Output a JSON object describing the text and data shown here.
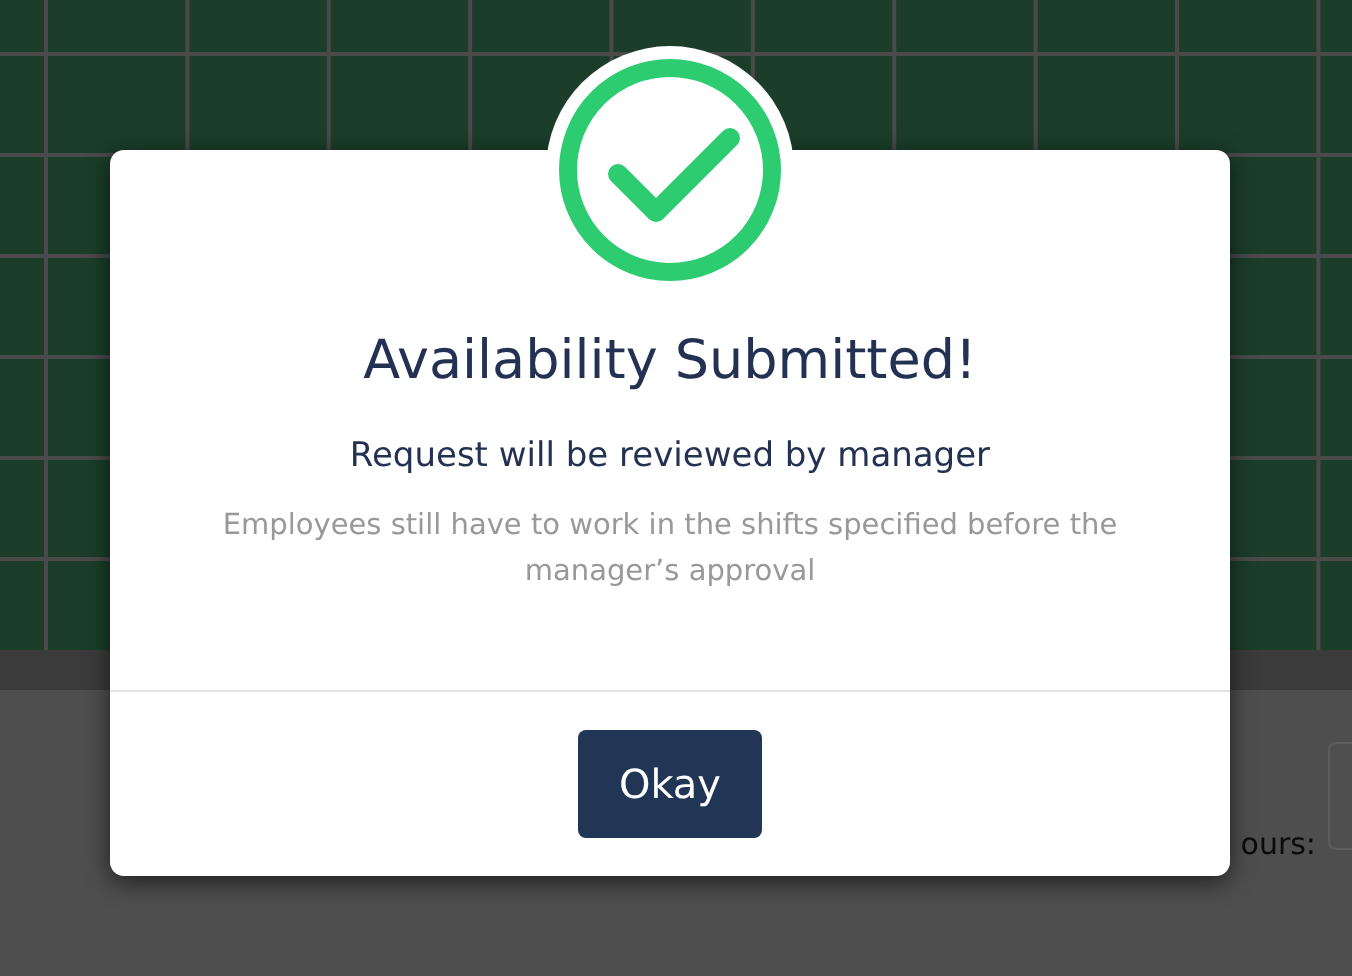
{
  "background": {
    "field_label": "ours:"
  },
  "dialog": {
    "title": "Availability Submitted!",
    "subtitle": "Request will be reviewed by manager",
    "message": "Employees still have to work in the shifts specified before the manager’s approval",
    "button": "Okay"
  }
}
